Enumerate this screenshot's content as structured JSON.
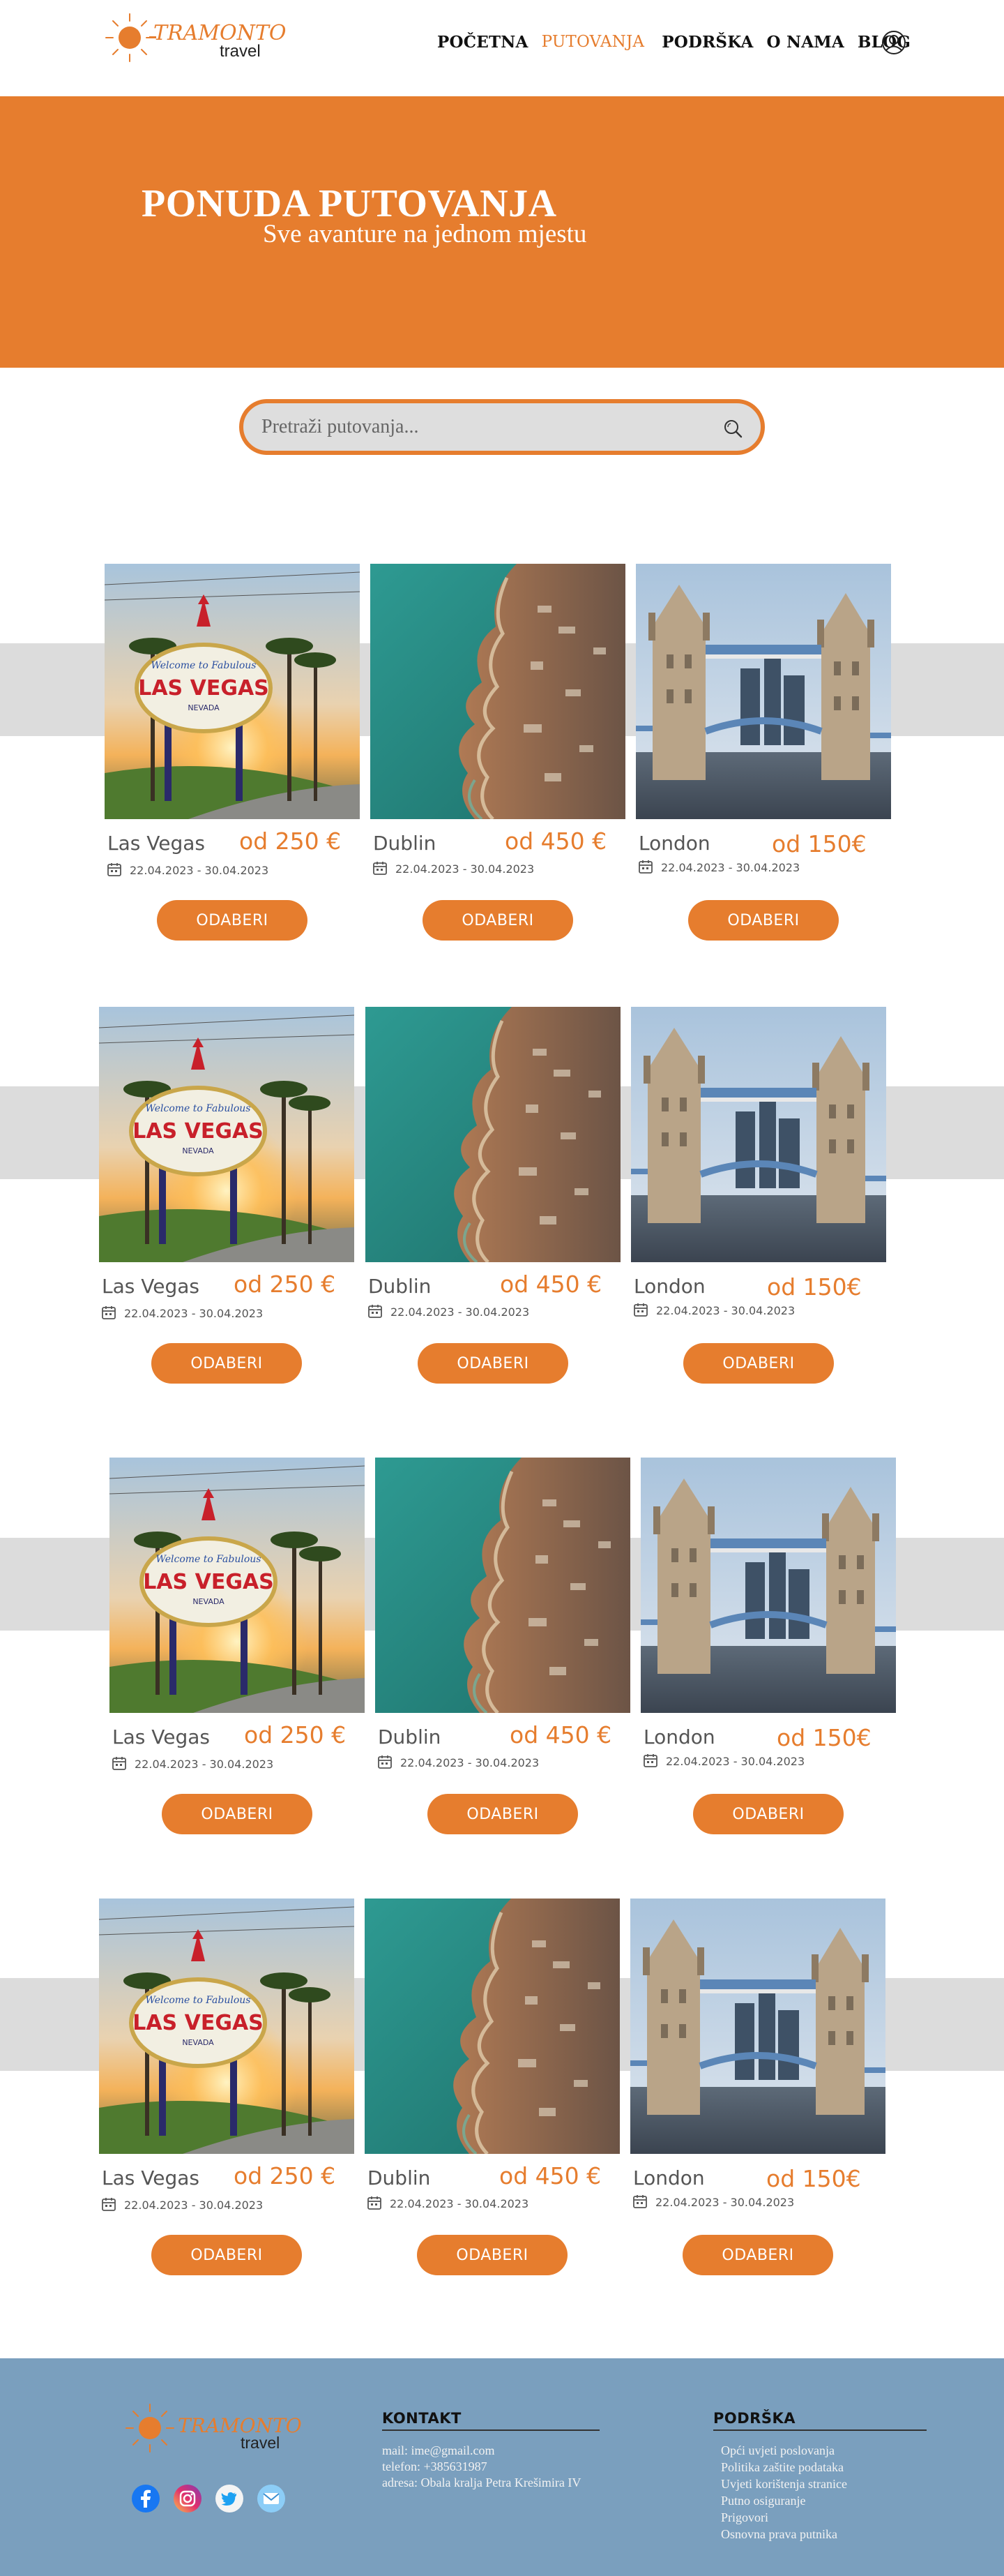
{
  "brand": {
    "name": "TRAMONTO",
    "tagline": "travel"
  },
  "nav": {
    "items": [
      {
        "label": "POČETNA",
        "active": false
      },
      {
        "label": "PUTOVANJA",
        "active": true
      },
      {
        "label": "PODRŠKA",
        "active": false
      },
      {
        "label": "O NAMA",
        "active": false
      },
      {
        "label": "BLOG",
        "active": false
      }
    ],
    "user_icon": "user-icon"
  },
  "hero": {
    "title": "PONUDA PUTOVANJA",
    "subtitle": "Sve avanture na jednom mjestu"
  },
  "search": {
    "placeholder": "Pretraži putovanja...",
    "icon": "search-icon"
  },
  "cards": [
    {
      "name": "Las Vegas",
      "price": "od 250 €",
      "dates": "22.04.2023 - 30.04.2023",
      "button": "ODABERI",
      "image": "las-vegas-sign"
    },
    {
      "name": "Dublin",
      "price": "od 450 €",
      "dates": "22.04.2023 - 30.04.2023",
      "button": "ODABERI",
      "image": "coastline-aerial"
    },
    {
      "name": "London",
      "price": "od 150€",
      "dates": "22.04.2023 - 30.04.2023",
      "button": "ODABERI",
      "image": "tower-bridge"
    }
  ],
  "footer": {
    "contact": {
      "heading": "KONTAKT",
      "lines": [
        "mail: ime@gmail.com",
        "telefon: +385631987",
        "adresa: Obala kralja Petra Krešimira IV"
      ]
    },
    "support": {
      "heading": "PODRŠKA",
      "lines": [
        "Opći uvjeti poslovanja",
        "Politika zaštite podataka",
        "Uvjeti korištenja stranice",
        "Putno osiguranje",
        "Prigovori",
        "Osnovna prava putnika"
      ]
    },
    "social": [
      "facebook-icon",
      "instagram-icon",
      "twitter-icon",
      "email-icon"
    ]
  },
  "colors": {
    "accent": "#e67d2e",
    "hero_bg": "#e67d2e",
    "band": "#dcdcdc",
    "footer_bg": "#7a9fbe"
  }
}
